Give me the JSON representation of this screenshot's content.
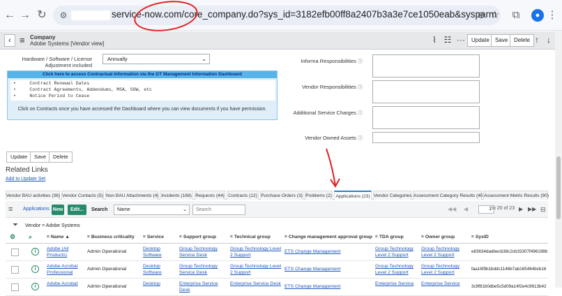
{
  "browser": {
    "url": "service-now.com/core_company.do?sys_id=3182efb00ff8a2407b3a3e7ce1050eab&sysparm_view=vendor&sysparm_record_target=core_..."
  },
  "header": {
    "title": "Company",
    "subtitle": "Adobe Systems [Vendor view]",
    "update_label": "Update",
    "save_label": "Save",
    "delete_label": "Delete"
  },
  "form": {
    "license_label_1": "Hardware / Software / License",
    "license_label_2": "Adjustment included",
    "license_value": "Annually",
    "info_head": "Click here to access Contractual Information via the GT Management Information Dashboard",
    "bullets": [
      "Contract Renewal Dates",
      "Contract Agreements, Addendums, MSA, SOW, etc",
      "Notice Period to Cease"
    ],
    "info_note": "Click on Contracts once you have accessed the Dashboard where you can view documents if you have permission.",
    "informa_resp": "Informa Responsibilities",
    "vendor_resp": "Vendor Responsibilities",
    "additional_charges": "Additional Service Charges",
    "vendor_assets": "Vendor Owned Assets",
    "update_btn": "Update",
    "save_btn": "Save",
    "delete_btn": "Delete"
  },
  "related": {
    "heading": "Related Links",
    "add_to_update_set": "Add to Update Set"
  },
  "tabs": [
    {
      "label": "Vendor BAU activities (36)"
    },
    {
      "label": "Vendor Contacts (5)"
    },
    {
      "label": "Non BAU Attachments (4)"
    },
    {
      "label": "Incidents (168)"
    },
    {
      "label": "Requests (44)"
    },
    {
      "label": "Contracts (12)"
    },
    {
      "label": "Purchase Orders (3)"
    },
    {
      "label": "Problems (2)"
    },
    {
      "label": "Applications (23)"
    },
    {
      "label": "Vendor Categories"
    },
    {
      "label": "Assessment Category Results (45)"
    },
    {
      "label": "Assessment Metric Results (90)"
    }
  ],
  "list": {
    "title": "Applications",
    "new_btn": "New",
    "edit_btn": "Edit...",
    "search_label": "Search",
    "search_field": "Name",
    "search_placeholder": "Search",
    "page_current": "1",
    "page_total": "to 20 of 23",
    "filter": "Vendor = Adobe Systems",
    "columns": [
      "Name ▲",
      "Business criticality",
      "Service",
      "Support group",
      "Technical group",
      "Change management approval group",
      "TDA group",
      "Owner group",
      "SysID"
    ],
    "rows": [
      {
        "name": "Adobe (All Products)",
        "criticality": "Admin Operational",
        "service": "Desktop Software",
        "support": "Group Technology Service Desk",
        "technical": "Group Technology Level 2 Support",
        "change": "ETS Change Management",
        "tda": "Group Technology Level 2 Support",
        "owner": "Group Technology Level 2 Support",
        "sysid": "e83634dadbecb38c2cb33307f496198b"
      },
      {
        "name": "Adobe Acrobat Professional",
        "criticality": "Admin Operational",
        "service": "Desktop Software",
        "support": "Group Technology Service Desk",
        "technical": "Group Technology Level 2 Support",
        "change": "ETS Change Management",
        "tda": "Group Technology Level 2 Support",
        "owner": "Group Technology Level 2 Support",
        "sysid": "faa16f9b1bddc1146b7ab165464bcb16"
      },
      {
        "name": "Adobe Acrobat",
        "criticality": "Admin Operational",
        "service": "Desktop",
        "support": "Enterprise Service Desk",
        "technical": "Enterprise Service Desk",
        "change": "ETS Change Management",
        "tda": "Enterprise Service",
        "owner": "Enterprise Service",
        "sysid": "3c9f81b0dbe5c5d09a14f2e4c9613b42"
      }
    ]
  }
}
